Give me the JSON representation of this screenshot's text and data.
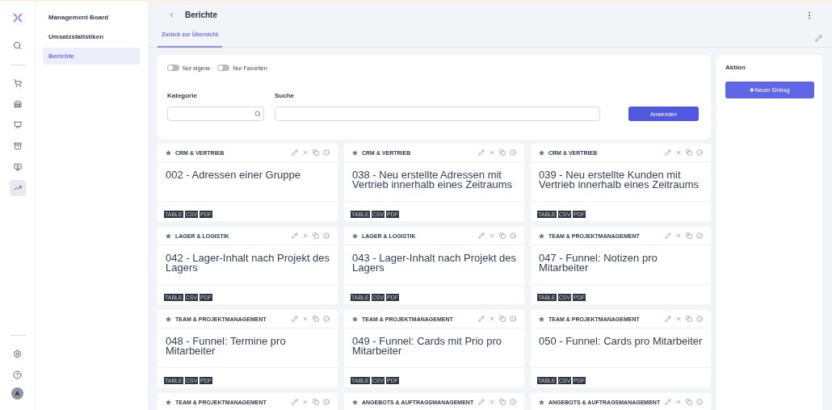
{
  "submenu": [
    {
      "label": "Management Board",
      "selected": false
    },
    {
      "label": "Umsatzstatistiken",
      "selected": false
    },
    {
      "label": "Berichte",
      "selected": true
    }
  ],
  "header": {
    "title": "Berichte"
  },
  "tabs": [
    {
      "label": "Zurück zur Übersicht",
      "selected": true
    }
  ],
  "filters": {
    "toggles": [
      {
        "label": "Nur eigene",
        "on": false
      },
      {
        "label": "Nur Favoriten",
        "on": false
      }
    ],
    "category": {
      "label": "Kategorie"
    },
    "search": {
      "label": "Suche"
    },
    "apply": "Anwenden"
  },
  "action": {
    "title": "Aktion",
    "button": "✚Neuer Eintrag"
  },
  "reports": [
    {
      "category": "CRM & VERTRIEB",
      "title": "002 - Adressen einer Gruppe",
      "formats": [
        "TABLE",
        "CSV",
        "PDF"
      ]
    },
    {
      "category": "CRM & VERTRIEB",
      "title": "038 - Neu erstellte Adressen mit Vertrieb innerhalb eines Zeitraums",
      "formats": [
        "TABLE",
        "CSV",
        "PDF"
      ]
    },
    {
      "category": "CRM & VERTRIEB",
      "title": "039 - Neu erstellte Kunden mit Vertrieb innerhalb eines Zeitraums",
      "formats": [
        "TABLE",
        "CSV",
        "PDF"
      ]
    },
    {
      "category": "LAGER & LOGISTIK",
      "title": "042 - Lager-Inhalt nach Projekt des Lagers",
      "formats": [
        "TABLE",
        "CSV",
        "PDF"
      ]
    },
    {
      "category": "LAGER & LOGISTIK",
      "title": "043 - Lager-Inhalt nach Projekt des Lagers",
      "formats": [
        "TABLE",
        "CSV",
        "PDF"
      ]
    },
    {
      "category": "TEAM & PROJEKTMANAGEMENT",
      "title": "047 - Funnel: Notizen pro Mitarbeiter",
      "formats": [
        "TABLE",
        "CSV",
        "PDF"
      ]
    },
    {
      "category": "TEAM & PROJEKTMANAGEMENT",
      "title": "048 - Funnel: Termine pro Mitarbeiter",
      "formats": [
        "TABLE",
        "CSV",
        "PDF"
      ]
    },
    {
      "category": "TEAM & PROJEKTMANAGEMENT",
      "title": "049 - Funnel: Cards mit Prio pro Mitarbeiter",
      "formats": [
        "TABLE",
        "CSV",
        "PDF"
      ]
    },
    {
      "category": "TEAM & PROJEKTMANAGEMENT",
      "title": "050 - Funnel: Cards pro Mitarbeiter",
      "formats": [
        "TABLE",
        "CSV",
        "PDF"
      ]
    },
    {
      "category": "TEAM & PROJEKTMANAGEMENT"
    },
    {
      "category": "ANGEBOTS & AUFTRAGSMANAGEMENT"
    },
    {
      "category": "ANGEBOTS & AUFTRAGSMANAGEMENT"
    }
  ],
  "user": {
    "initial": "A"
  }
}
